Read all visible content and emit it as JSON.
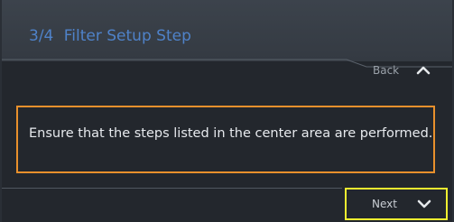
{
  "wizard": {
    "step_number": "3/4",
    "step_title": "Filter Setup Step",
    "back_label": "Back",
    "next_label": "Next",
    "message": "Ensure that the steps listed in the center area are performed."
  },
  "colors": {
    "title_text": "#4f82c9",
    "message_border": "#e8902c",
    "next_highlight": "#f0f030",
    "panel_bg": "#23272d",
    "header_bg": "#3c434c"
  },
  "icons": {
    "back": "chevron-up-icon",
    "next": "chevron-down-icon"
  }
}
